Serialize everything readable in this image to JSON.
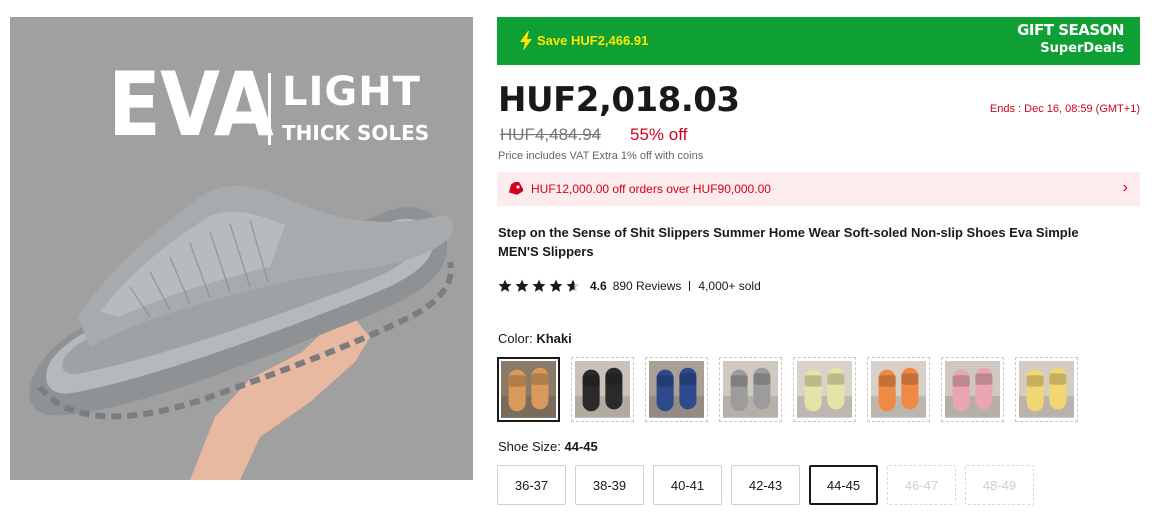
{
  "hero": {
    "eva": "EVA",
    "light": "LIGHT",
    "thick_soles": "THICK SOLES"
  },
  "deal": {
    "save_text": "Save HUF2,466.91",
    "brand_line1": "GIFT SEASON",
    "brand_line2": "SuperDeals",
    "bg_color": "#0fa035",
    "save_color": "#ffe600"
  },
  "price": {
    "current": "HUF2,018.03",
    "original": "HUF4,484.94",
    "discount": "55% off",
    "ends": "Ends :  Dec 16, 08:59 (GMT+1)",
    "vat_note": "Price includes VAT Extra 1% off with coins",
    "accent_color": "#d0021b"
  },
  "coupon": {
    "text": "HUF12,000.00 off orders over HUF90,000.00",
    "chevron": "›"
  },
  "product": {
    "title": "Step on the Sense of Shit Slippers Summer Home Wear Soft-soled Non-slip Shoes Eva Simple MEN'S Slippers"
  },
  "rating": {
    "score_value": 4.6,
    "score": "4.6",
    "reviews": "890 Reviews",
    "sold": "4,000+ sold"
  },
  "color": {
    "label": "Color:",
    "selected": "Khaki",
    "swatches": [
      {
        "name": "Khaki",
        "color": "#d89a5a",
        "bg": "#8a7a6a",
        "selected": true
      },
      {
        "name": "Black",
        "color": "#2a2a2a",
        "bg": "#c9c2b8",
        "selected": false
      },
      {
        "name": "Blue",
        "color": "#2d4a8c",
        "bg": "#a9a095",
        "selected": false
      },
      {
        "name": "Gray",
        "color": "#9c9c9c",
        "bg": "#cfc9c2",
        "selected": false
      },
      {
        "name": "Light Yellow",
        "color": "#e6e3a8",
        "bg": "#d8d2c8",
        "selected": false
      },
      {
        "name": "Orange",
        "color": "#ef8a45",
        "bg": "#d6d0c8",
        "selected": false
      },
      {
        "name": "Pink",
        "color": "#e8a6b0",
        "bg": "#cfc8c0",
        "selected": false
      },
      {
        "name": "Yellow",
        "color": "#f1d774",
        "bg": "#d3ccc3",
        "selected": false
      }
    ]
  },
  "size": {
    "label": "Shoe Size:",
    "selected": "44-45",
    "options": [
      {
        "label": "36-37",
        "state": "normal"
      },
      {
        "label": "38-39",
        "state": "normal"
      },
      {
        "label": "40-41",
        "state": "normal"
      },
      {
        "label": "42-43",
        "state": "normal"
      },
      {
        "label": "44-45",
        "state": "selected"
      },
      {
        "label": "46-47",
        "state": "disabled"
      },
      {
        "label": "48-49",
        "state": "disabled"
      }
    ]
  }
}
